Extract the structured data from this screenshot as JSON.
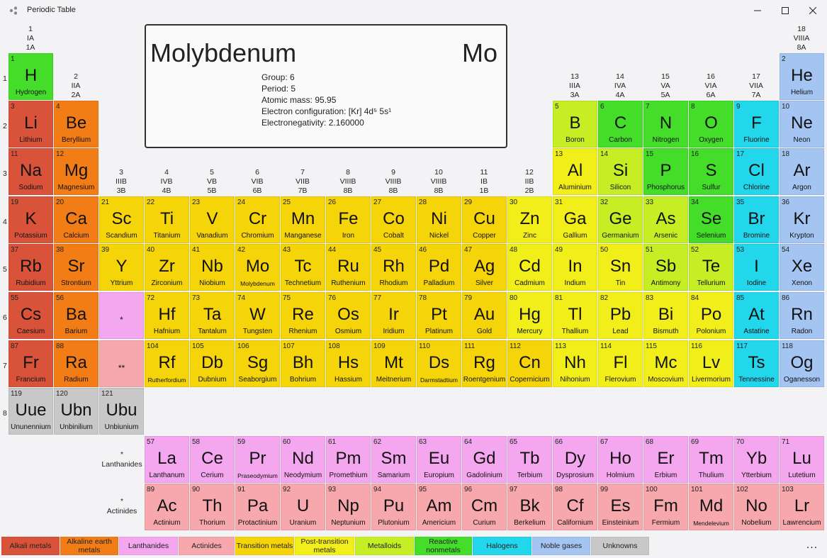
{
  "window": {
    "title": "Periodic Table"
  },
  "group_headers": [
    {
      "n": "1",
      "r": "IA",
      "a": "1A"
    },
    {
      "n": "2",
      "r": "IIA",
      "a": "2A"
    },
    {
      "n": "3",
      "r": "IIIB",
      "a": "3B"
    },
    {
      "n": "4",
      "r": "IVB",
      "a": "4B"
    },
    {
      "n": "5",
      "r": "VB",
      "a": "5B"
    },
    {
      "n": "6",
      "r": "VIB",
      "a": "6B"
    },
    {
      "n": "7",
      "r": "VIIB",
      "a": "7B"
    },
    {
      "n": "8",
      "r": "VIIIB",
      "a": "8B"
    },
    {
      "n": "9",
      "r": "VIIIB",
      "a": "8B"
    },
    {
      "n": "10",
      "r": "VIIIB",
      "a": "8B"
    },
    {
      "n": "11",
      "r": "IB",
      "a": "1B"
    },
    {
      "n": "12",
      "r": "IIB",
      "a": "2B"
    },
    {
      "n": "13",
      "r": "IIIA",
      "a": "3A"
    },
    {
      "n": "14",
      "r": "IVA",
      "a": "4A"
    },
    {
      "n": "15",
      "r": "VA",
      "a": "5A"
    },
    {
      "n": "16",
      "r": "VIA",
      "a": "6A"
    },
    {
      "n": "17",
      "r": "VIIA",
      "a": "7A"
    },
    {
      "n": "18",
      "r": "VIIIA",
      "a": "8A"
    }
  ],
  "period_labels": [
    "1",
    "2",
    "3",
    "4",
    "5",
    "6",
    "7",
    "8"
  ],
  "series_labels": {
    "lanthanides": {
      "marker": "*",
      "label": "Lanthanides"
    },
    "actinides": {
      "marker": "*",
      "label": "Actinides"
    }
  },
  "details": {
    "name": "Molybdenum",
    "symbol": "Mo",
    "group": "Group: 6",
    "period": "Period: 5",
    "mass": "Atomic mass: 95.95",
    "config": "Electron configuration: [Kr] 4d⁵ 5s¹",
    "electroneg": "Electronegativity: 2.160000"
  },
  "colors": {
    "alkali": "#d9533b",
    "alkaline": "#f27d17",
    "lanthanide": "#f4a6ef",
    "actinide": "#f7a8ad",
    "transition": "#f5d40a",
    "post": "#f2ee1a",
    "metalloid": "#c5ee24",
    "nonmetal": "#44dd2a",
    "halogen": "#22d6ec",
    "noble": "#a4c4f2",
    "unknown": "#c8c8c8"
  },
  "elements": [
    {
      "n": "1",
      "s": "H",
      "name": "Hydrogen",
      "c": "nonmetal",
      "col": 1,
      "row": 1
    },
    {
      "n": "2",
      "s": "He",
      "name": "Helium",
      "c": "noble",
      "col": 18,
      "row": 1
    },
    {
      "n": "3",
      "s": "Li",
      "name": "Lithium",
      "c": "alkali",
      "col": 1,
      "row": 2
    },
    {
      "n": "4",
      "s": "Be",
      "name": "Beryllium",
      "c": "alkaline",
      "col": 2,
      "row": 2
    },
    {
      "n": "5",
      "s": "B",
      "name": "Boron",
      "c": "metalloid",
      "col": 13,
      "row": 2
    },
    {
      "n": "6",
      "s": "C",
      "name": "Carbon",
      "c": "nonmetal",
      "col": 14,
      "row": 2
    },
    {
      "n": "7",
      "s": "N",
      "name": "Nitrogen",
      "c": "nonmetal",
      "col": 15,
      "row": 2
    },
    {
      "n": "8",
      "s": "O",
      "name": "Oxygen",
      "c": "nonmetal",
      "col": 16,
      "row": 2
    },
    {
      "n": "9",
      "s": "F",
      "name": "Fluorine",
      "c": "halogen",
      "col": 17,
      "row": 2
    },
    {
      "n": "10",
      "s": "Ne",
      "name": "Neon",
      "c": "noble",
      "col": 18,
      "row": 2
    },
    {
      "n": "11",
      "s": "Na",
      "name": "Sodium",
      "c": "alkali",
      "col": 1,
      "row": 3
    },
    {
      "n": "12",
      "s": "Mg",
      "name": "Magnesium",
      "c": "alkaline",
      "col": 2,
      "row": 3
    },
    {
      "n": "13",
      "s": "Al",
      "name": "Aluminium",
      "c": "post",
      "col": 13,
      "row": 3
    },
    {
      "n": "14",
      "s": "Si",
      "name": "Silicon",
      "c": "metalloid",
      "col": 14,
      "row": 3
    },
    {
      "n": "15",
      "s": "P",
      "name": "Phosphorus",
      "c": "nonmetal",
      "col": 15,
      "row": 3
    },
    {
      "n": "16",
      "s": "S",
      "name": "Sulfur",
      "c": "nonmetal",
      "col": 16,
      "row": 3
    },
    {
      "n": "17",
      "s": "Cl",
      "name": "Chlorine",
      "c": "halogen",
      "col": 17,
      "row": 3
    },
    {
      "n": "18",
      "s": "Ar",
      "name": "Argon",
      "c": "noble",
      "col": 18,
      "row": 3
    },
    {
      "n": "19",
      "s": "K",
      "name": "Potassium",
      "c": "alkali",
      "col": 1,
      "row": 4
    },
    {
      "n": "20",
      "s": "Ca",
      "name": "Calcium",
      "c": "alkaline",
      "col": 2,
      "row": 4
    },
    {
      "n": "21",
      "s": "Sc",
      "name": "Scandium",
      "c": "transition",
      "col": 3,
      "row": 4
    },
    {
      "n": "22",
      "s": "Ti",
      "name": "Titanium",
      "c": "transition",
      "col": 4,
      "row": 4
    },
    {
      "n": "23",
      "s": "V",
      "name": "Vanadium",
      "c": "transition",
      "col": 5,
      "row": 4
    },
    {
      "n": "24",
      "s": "Cr",
      "name": "Chromium",
      "c": "transition",
      "col": 6,
      "row": 4
    },
    {
      "n": "25",
      "s": "Mn",
      "name": "Manganese",
      "c": "transition",
      "col": 7,
      "row": 4
    },
    {
      "n": "26",
      "s": "Fe",
      "name": "Iron",
      "c": "transition",
      "col": 8,
      "row": 4
    },
    {
      "n": "27",
      "s": "Co",
      "name": "Cobalt",
      "c": "transition",
      "col": 9,
      "row": 4
    },
    {
      "n": "28",
      "s": "Ni",
      "name": "Nickel",
      "c": "transition",
      "col": 10,
      "row": 4
    },
    {
      "n": "29",
      "s": "Cu",
      "name": "Copper",
      "c": "transition",
      "col": 11,
      "row": 4
    },
    {
      "n": "30",
      "s": "Zn",
      "name": "Zinc",
      "c": "post",
      "col": 12,
      "row": 4
    },
    {
      "n": "31",
      "s": "Ga",
      "name": "Gallium",
      "c": "post",
      "col": 13,
      "row": 4
    },
    {
      "n": "32",
      "s": "Ge",
      "name": "Germanium",
      "c": "metalloid",
      "col": 14,
      "row": 4
    },
    {
      "n": "33",
      "s": "As",
      "name": "Arsenic",
      "c": "metalloid",
      "col": 15,
      "row": 4
    },
    {
      "n": "34",
      "s": "Se",
      "name": "Selenium",
      "c": "nonmetal",
      "col": 16,
      "row": 4
    },
    {
      "n": "35",
      "s": "Br",
      "name": "Bromine",
      "c": "halogen",
      "col": 17,
      "row": 4
    },
    {
      "n": "36",
      "s": "Kr",
      "name": "Krypton",
      "c": "noble",
      "col": 18,
      "row": 4
    },
    {
      "n": "37",
      "s": "Rb",
      "name": "Rubidium",
      "c": "alkali",
      "col": 1,
      "row": 5
    },
    {
      "n": "38",
      "s": "Sr",
      "name": "Strontium",
      "c": "alkaline",
      "col": 2,
      "row": 5
    },
    {
      "n": "39",
      "s": "Y",
      "name": "Yttrium",
      "c": "transition",
      "col": 3,
      "row": 5
    },
    {
      "n": "40",
      "s": "Zr",
      "name": "Zirconium",
      "c": "transition",
      "col": 4,
      "row": 5
    },
    {
      "n": "41",
      "s": "Nb",
      "name": "Niobium",
      "c": "transition",
      "col": 5,
      "row": 5
    },
    {
      "n": "42",
      "s": "Mo",
      "name": "Molybdenum",
      "c": "transition",
      "col": 6,
      "row": 5,
      "small": true
    },
    {
      "n": "43",
      "s": "Tc",
      "name": "Technetium",
      "c": "transition",
      "col": 7,
      "row": 5
    },
    {
      "n": "44",
      "s": "Ru",
      "name": "Ruthenium",
      "c": "transition",
      "col": 8,
      "row": 5
    },
    {
      "n": "45",
      "s": "Rh",
      "name": "Rhodium",
      "c": "transition",
      "col": 9,
      "row": 5
    },
    {
      "n": "46",
      "s": "Pd",
      "name": "Palladium",
      "c": "transition",
      "col": 10,
      "row": 5
    },
    {
      "n": "47",
      "s": "Ag",
      "name": "Silver",
      "c": "transition",
      "col": 11,
      "row": 5
    },
    {
      "n": "48",
      "s": "Cd",
      "name": "Cadmium",
      "c": "post",
      "col": 12,
      "row": 5
    },
    {
      "n": "49",
      "s": "In",
      "name": "Indium",
      "c": "post",
      "col": 13,
      "row": 5
    },
    {
      "n": "50",
      "s": "Sn",
      "name": "Tin",
      "c": "post",
      "col": 14,
      "row": 5
    },
    {
      "n": "51",
      "s": "Sb",
      "name": "Antimony",
      "c": "metalloid",
      "col": 15,
      "row": 5
    },
    {
      "n": "52",
      "s": "Te",
      "name": "Tellurium",
      "c": "metalloid",
      "col": 16,
      "row": 5
    },
    {
      "n": "53",
      "s": "I",
      "name": "Iodine",
      "c": "halogen",
      "col": 17,
      "row": 5
    },
    {
      "n": "54",
      "s": "Xe",
      "name": "Xenon",
      "c": "noble",
      "col": 18,
      "row": 5
    },
    {
      "n": "55",
      "s": "Cs",
      "name": "Caesium",
      "c": "alkali",
      "col": 1,
      "row": 6
    },
    {
      "n": "56",
      "s": "Ba",
      "name": "Barium",
      "c": "alkaline",
      "col": 2,
      "row": 6
    },
    {
      "n": "",
      "s": "*",
      "name": "",
      "c": "lanthanide",
      "col": 3,
      "row": 6,
      "marker": true
    },
    {
      "n": "72",
      "s": "Hf",
      "name": "Hafnium",
      "c": "transition",
      "col": 4,
      "row": 6
    },
    {
      "n": "73",
      "s": "Ta",
      "name": "Tantalum",
      "c": "transition",
      "col": 5,
      "row": 6
    },
    {
      "n": "74",
      "s": "W",
      "name": "Tungsten",
      "c": "transition",
      "col": 6,
      "row": 6
    },
    {
      "n": "75",
      "s": "Re",
      "name": "Rhenium",
      "c": "transition",
      "col": 7,
      "row": 6
    },
    {
      "n": "76",
      "s": "Os",
      "name": "Osmium",
      "c": "transition",
      "col": 8,
      "row": 6
    },
    {
      "n": "77",
      "s": "Ir",
      "name": "Iridium",
      "c": "transition",
      "col": 9,
      "row": 6
    },
    {
      "n": "78",
      "s": "Pt",
      "name": "Platinum",
      "c": "transition",
      "col": 10,
      "row": 6
    },
    {
      "n": "79",
      "s": "Au",
      "name": "Gold",
      "c": "transition",
      "col": 11,
      "row": 6
    },
    {
      "n": "80",
      "s": "Hg",
      "name": "Mercury",
      "c": "post",
      "col": 12,
      "row": 6
    },
    {
      "n": "81",
      "s": "Tl",
      "name": "Thallium",
      "c": "post",
      "col": 13,
      "row": 6
    },
    {
      "n": "82",
      "s": "Pb",
      "name": "Lead",
      "c": "post",
      "col": 14,
      "row": 6
    },
    {
      "n": "83",
      "s": "Bi",
      "name": "Bismuth",
      "c": "post",
      "col": 15,
      "row": 6
    },
    {
      "n": "84",
      "s": "Po",
      "name": "Polonium",
      "c": "post",
      "col": 16,
      "row": 6
    },
    {
      "n": "85",
      "s": "At",
      "name": "Astatine",
      "c": "halogen",
      "col": 17,
      "row": 6
    },
    {
      "n": "86",
      "s": "Rn",
      "name": "Radon",
      "c": "noble",
      "col": 18,
      "row": 6
    },
    {
      "n": "87",
      "s": "Fr",
      "name": "Francium",
      "c": "alkali",
      "col": 1,
      "row": 7
    },
    {
      "n": "88",
      "s": "Ra",
      "name": "Radium",
      "c": "alkaline",
      "col": 2,
      "row": 7
    },
    {
      "n": "",
      "s": "**",
      "name": "",
      "c": "actinide",
      "col": 3,
      "row": 7,
      "marker": true
    },
    {
      "n": "104",
      "s": "Rf",
      "name": "Rutherfordium",
      "c": "transition",
      "col": 4,
      "row": 7,
      "small": true
    },
    {
      "n": "105",
      "s": "Db",
      "name": "Dubnium",
      "c": "transition",
      "col": 5,
      "row": 7
    },
    {
      "n": "106",
      "s": "Sg",
      "name": "Seaborgium",
      "c": "transition",
      "col": 6,
      "row": 7
    },
    {
      "n": "107",
      "s": "Bh",
      "name": "Bohrium",
      "c": "transition",
      "col": 7,
      "row": 7
    },
    {
      "n": "108",
      "s": "Hs",
      "name": "Hassium",
      "c": "transition",
      "col": 8,
      "row": 7
    },
    {
      "n": "109",
      "s": "Mt",
      "name": "Meitnerium",
      "c": "transition",
      "col": 9,
      "row": 7
    },
    {
      "n": "110",
      "s": "Ds",
      "name": "Darmstadtium",
      "c": "transition",
      "col": 10,
      "row": 7,
      "small": true
    },
    {
      "n": "111",
      "s": "Rg",
      "name": "Roentgenium",
      "c": "transition",
      "col": 11,
      "row": 7
    },
    {
      "n": "112",
      "s": "Cn",
      "name": "Copernicium",
      "c": "transition",
      "col": 12,
      "row": 7
    },
    {
      "n": "113",
      "s": "Nh",
      "name": "Nihonium",
      "c": "post",
      "col": 13,
      "row": 7
    },
    {
      "n": "114",
      "s": "Fl",
      "name": "Flerovium",
      "c": "post",
      "col": 14,
      "row": 7
    },
    {
      "n": "115",
      "s": "Mc",
      "name": "Moscovium",
      "c": "post",
      "col": 15,
      "row": 7
    },
    {
      "n": "116",
      "s": "Lv",
      "name": "Livermorium",
      "c": "post",
      "col": 16,
      "row": 7
    },
    {
      "n": "117",
      "s": "Ts",
      "name": "Tennessine",
      "c": "halogen",
      "col": 17,
      "row": 7
    },
    {
      "n": "118",
      "s": "Og",
      "name": "Oganesson",
      "c": "noble",
      "col": 18,
      "row": 7
    },
    {
      "n": "119",
      "s": "Uue",
      "name": "Ununennium",
      "c": "unknown",
      "col": 1,
      "row": 8
    },
    {
      "n": "120",
      "s": "Ubn",
      "name": "Unbinilium",
      "c": "unknown",
      "col": 2,
      "row": 8
    },
    {
      "n": "121",
      "s": "Ubu",
      "name": "Unbiunium",
      "c": "unknown",
      "col": 3,
      "row": 8
    },
    {
      "n": "57",
      "s": "La",
      "name": "Lanthanum",
      "c": "lanthanide",
      "col": 4,
      "row": 9
    },
    {
      "n": "58",
      "s": "Ce",
      "name": "Cerium",
      "c": "lanthanide",
      "col": 5,
      "row": 9
    },
    {
      "n": "59",
      "s": "Pr",
      "name": "Praseodymium",
      "c": "lanthanide",
      "col": 6,
      "row": 9,
      "small": true
    },
    {
      "n": "60",
      "s": "Nd",
      "name": "Neodymium",
      "c": "lanthanide",
      "col": 7,
      "row": 9
    },
    {
      "n": "61",
      "s": "Pm",
      "name": "Promethium",
      "c": "lanthanide",
      "col": 8,
      "row": 9
    },
    {
      "n": "62",
      "s": "Sm",
      "name": "Samarium",
      "c": "lanthanide",
      "col": 9,
      "row": 9
    },
    {
      "n": "63",
      "s": "Eu",
      "name": "Europium",
      "c": "lanthanide",
      "col": 10,
      "row": 9
    },
    {
      "n": "64",
      "s": "Gd",
      "name": "Gadolinium",
      "c": "lanthanide",
      "col": 11,
      "row": 9
    },
    {
      "n": "65",
      "s": "Tb",
      "name": "Terbium",
      "c": "lanthanide",
      "col": 12,
      "row": 9
    },
    {
      "n": "66",
      "s": "Dy",
      "name": "Dysprosium",
      "c": "lanthanide",
      "col": 13,
      "row": 9
    },
    {
      "n": "67",
      "s": "Ho",
      "name": "Holmium",
      "c": "lanthanide",
      "col": 14,
      "row": 9
    },
    {
      "n": "68",
      "s": "Er",
      "name": "Erbium",
      "c": "lanthanide",
      "col": 15,
      "row": 9
    },
    {
      "n": "69",
      "s": "Tm",
      "name": "Thulium",
      "c": "lanthanide",
      "col": 16,
      "row": 9
    },
    {
      "n": "70",
      "s": "Yb",
      "name": "Ytterbium",
      "c": "lanthanide",
      "col": 17,
      "row": 9
    },
    {
      "n": "71",
      "s": "Lu",
      "name": "Lutetium",
      "c": "lanthanide",
      "col": 18,
      "row": 9
    },
    {
      "n": "89",
      "s": "Ac",
      "name": "Actinium",
      "c": "actinide",
      "col": 4,
      "row": 10
    },
    {
      "n": "90",
      "s": "Th",
      "name": "Thorium",
      "c": "actinide",
      "col": 5,
      "row": 10
    },
    {
      "n": "91",
      "s": "Pa",
      "name": "Protactinium",
      "c": "actinide",
      "col": 6,
      "row": 10
    },
    {
      "n": "92",
      "s": "U",
      "name": "Uranium",
      "c": "actinide",
      "col": 7,
      "row": 10
    },
    {
      "n": "93",
      "s": "Np",
      "name": "Neptunium",
      "c": "actinide",
      "col": 8,
      "row": 10
    },
    {
      "n": "94",
      "s": "Pu",
      "name": "Plutonium",
      "c": "actinide",
      "col": 9,
      "row": 10
    },
    {
      "n": "95",
      "s": "Am",
      "name": "Americium",
      "c": "actinide",
      "col": 10,
      "row": 10
    },
    {
      "n": "96",
      "s": "Cm",
      "name": "Curium",
      "c": "actinide",
      "col": 11,
      "row": 10
    },
    {
      "n": "97",
      "s": "Bk",
      "name": "Berkelium",
      "c": "actinide",
      "col": 12,
      "row": 10
    },
    {
      "n": "98",
      "s": "Cf",
      "name": "Californium",
      "c": "actinide",
      "col": 13,
      "row": 10
    },
    {
      "n": "99",
      "s": "Es",
      "name": "Einsteinium",
      "c": "actinide",
      "col": 14,
      "row": 10
    },
    {
      "n": "100",
      "s": "Fm",
      "name": "Fermium",
      "c": "actinide",
      "col": 15,
      "row": 10
    },
    {
      "n": "101",
      "s": "Md",
      "name": "Mendelevium",
      "c": "actinide",
      "col": 16,
      "row": 10,
      "small": true
    },
    {
      "n": "102",
      "s": "No",
      "name": "Nobelium",
      "c": "actinide",
      "col": 17,
      "row": 10
    },
    {
      "n": "103",
      "s": "Lr",
      "name": "Lawrencium",
      "c": "actinide",
      "col": 18,
      "row": 10
    }
  ],
  "legend": [
    {
      "label": "Alkali metals",
      "c": "alkali"
    },
    {
      "label": "Alkaline earth metals",
      "c": "alkaline"
    },
    {
      "label": "Lanthanides",
      "c": "lanthanide"
    },
    {
      "label": "Actinides",
      "c": "actinide"
    },
    {
      "label": "Transition metals",
      "c": "transition"
    },
    {
      "label": "Post-transition metals",
      "c": "post"
    },
    {
      "label": "Metalloids",
      "c": "metalloid"
    },
    {
      "label": "Reactive nonmetals",
      "c": "nonmetal"
    },
    {
      "label": "Halogens",
      "c": "halogen"
    },
    {
      "label": "Noble gases",
      "c": "noble"
    },
    {
      "label": "Unknowns",
      "c": "unknown"
    }
  ],
  "more_label": "..."
}
